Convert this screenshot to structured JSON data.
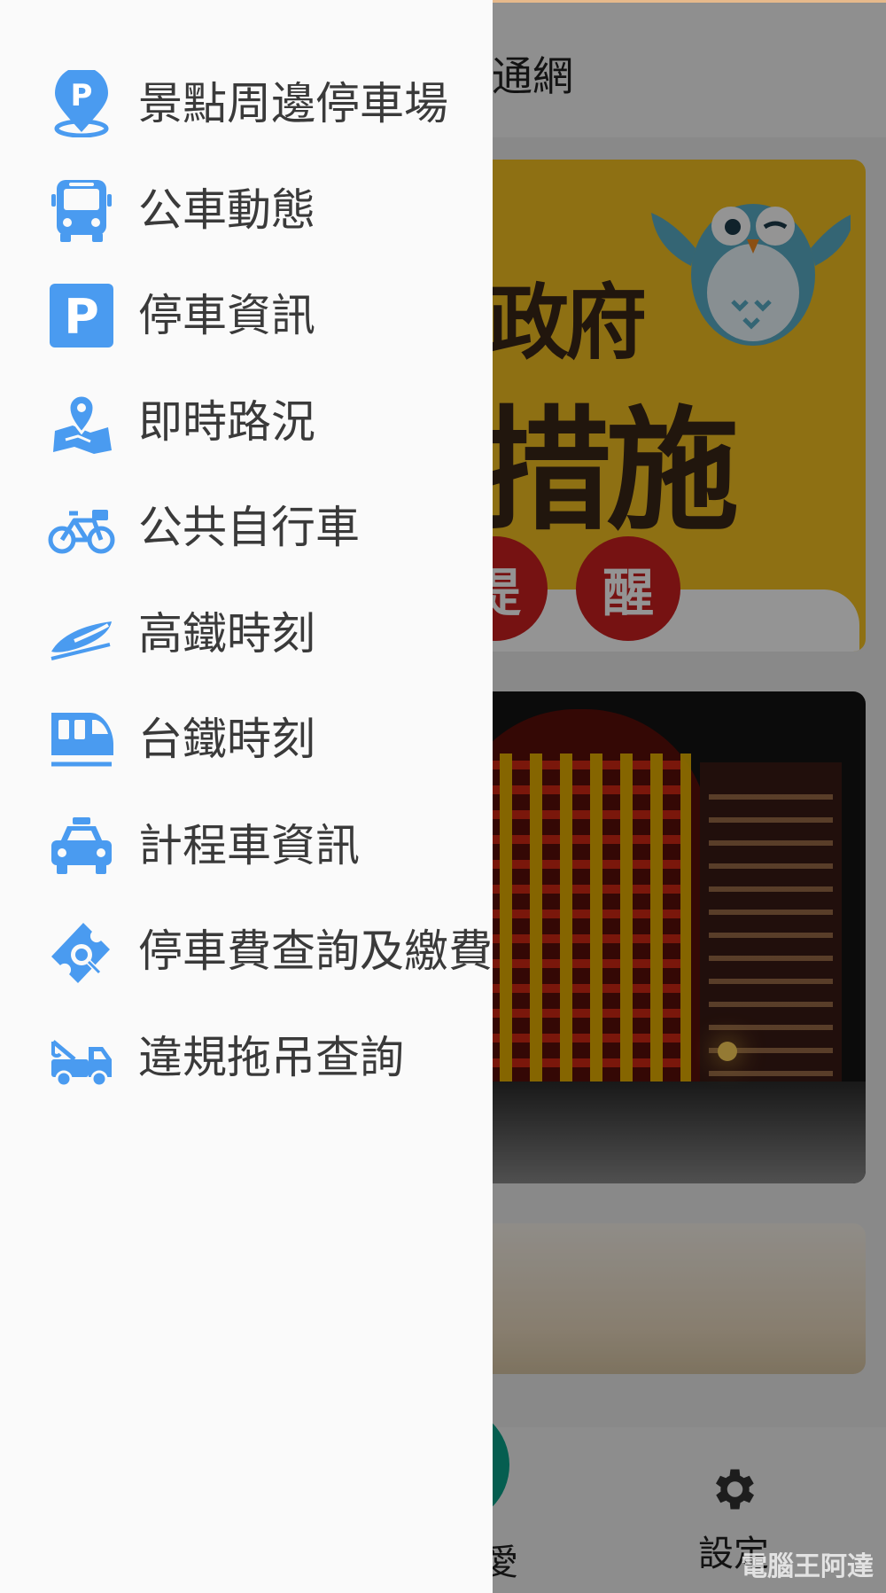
{
  "app": {
    "title_fragment": "通網",
    "bottom_nav": {
      "left_label_fragment": "愛",
      "settings_label": "設定"
    },
    "cards": {
      "card1": {
        "line1": "政府",
        "line2": "措施",
        "circle1": "提",
        "circle2": "醒"
      }
    },
    "watermark": "電腦王阿達"
  },
  "drawer": {
    "items": [
      {
        "label": "景點周邊停車場",
        "icon": "parking-location-pin-icon"
      },
      {
        "label": "公車動態",
        "icon": "bus-icon"
      },
      {
        "label": "停車資訊",
        "icon": "parking-sign-icon"
      },
      {
        "label": "即時路況",
        "icon": "map-pin-icon"
      },
      {
        "label": "公共自行車",
        "icon": "bicycle-icon"
      },
      {
        "label": "高鐵時刻",
        "icon": "high-speed-rail-icon"
      },
      {
        "label": "台鐵時刻",
        "icon": "train-icon"
      },
      {
        "label": "計程車資訊",
        "icon": "taxi-icon"
      },
      {
        "label": "停車費查詢及繳費",
        "icon": "ticket-search-icon"
      },
      {
        "label": "違規拖吊查詢",
        "icon": "tow-truck-icon"
      }
    ],
    "icon_color": "#4a9bf0"
  },
  "colors": {
    "accent_blue": "#4a9bf0",
    "scrim": "rgba(0,0,0,0.42)",
    "banner_yellow": "#f5c221"
  }
}
